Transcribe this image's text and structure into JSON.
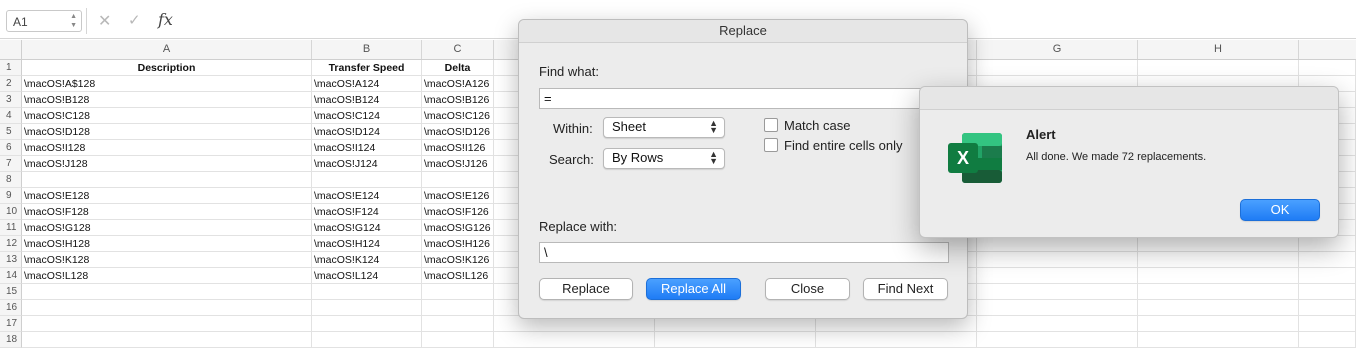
{
  "formula_bar": {
    "name_box": "A1",
    "fx_label": "fx",
    "formula": ""
  },
  "columns": [
    "A",
    "B",
    "C",
    "G",
    "H"
  ],
  "rows": [
    {
      "n": "1",
      "a": "Description",
      "b": "Transfer Speed",
      "c": "Delta"
    },
    {
      "n": "2",
      "a": "\\macOS!A$128",
      "b": "\\macOS!A124",
      "c": "\\macOS!A126"
    },
    {
      "n": "3",
      "a": "\\macOS!B128",
      "b": "\\macOS!B124",
      "c": "\\macOS!B126"
    },
    {
      "n": "4",
      "a": "\\macOS!C128",
      "b": "\\macOS!C124",
      "c": "\\macOS!C126"
    },
    {
      "n": "5",
      "a": "\\macOS!D128",
      "b": "\\macOS!D124",
      "c": "\\macOS!D126"
    },
    {
      "n": "6",
      "a": "\\macOS!I128",
      "b": "\\macOS!I124",
      "c": "\\macOS!I126"
    },
    {
      "n": "7",
      "a": "\\macOS!J128",
      "b": "\\macOS!J124",
      "c": "\\macOS!J126"
    },
    {
      "n": "8",
      "a": "",
      "b": "",
      "c": ""
    },
    {
      "n": "9",
      "a": "\\macOS!E128",
      "b": "\\macOS!E124",
      "c": "\\macOS!E126"
    },
    {
      "n": "10",
      "a": "\\macOS!F128",
      "b": "\\macOS!F124",
      "c": "\\macOS!F126"
    },
    {
      "n": "11",
      "a": "\\macOS!G128",
      "b": "\\macOS!G124",
      "c": "\\macOS!G126"
    },
    {
      "n": "12",
      "a": "\\macOS!H128",
      "b": "\\macOS!H124",
      "c": "\\macOS!H126"
    },
    {
      "n": "13",
      "a": "\\macOS!K128",
      "b": "\\macOS!K124",
      "c": "\\macOS!K126"
    },
    {
      "n": "14",
      "a": "\\macOS!L128",
      "b": "\\macOS!L124",
      "c": "\\macOS!L126"
    },
    {
      "n": "15",
      "a": "",
      "b": "",
      "c": ""
    },
    {
      "n": "16",
      "a": "",
      "b": "",
      "c": ""
    },
    {
      "n": "17",
      "a": "",
      "b": "",
      "c": ""
    },
    {
      "n": "18",
      "a": "",
      "b": "",
      "c": ""
    }
  ],
  "replace_dialog": {
    "title": "Replace",
    "find_label": "Find what:",
    "find_value": "=",
    "within_label": "Within:",
    "within_value": "Sheet",
    "search_label": "Search:",
    "search_value": "By Rows",
    "match_case": "Match case",
    "entire_cells": "Find entire cells only",
    "replace_label": "Replace with:",
    "replace_value": "\\",
    "btn_replace": "Replace",
    "btn_replace_all": "Replace All",
    "btn_close": "Close",
    "btn_find_next": "Find Next"
  },
  "alert": {
    "title": "Alert",
    "message": "All done. We made 72 replacements.",
    "ok": "OK",
    "icon": "excel-app-icon"
  }
}
